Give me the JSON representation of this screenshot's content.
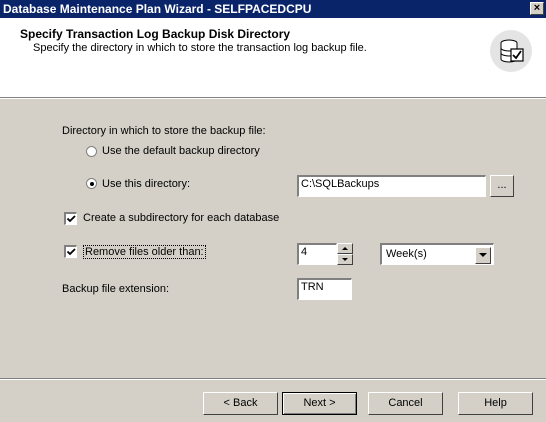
{
  "window": {
    "title": "Database Maintenance Plan Wizard - SELFPACEDCPU",
    "close_glyph": "×"
  },
  "header": {
    "title": "Specify Transaction Log Backup Disk Directory",
    "subtitle": "Specify the directory in which to store the transaction log backup file.",
    "icon": "database-check-icon"
  },
  "form": {
    "directory_label": "Directory in which to store the backup file:",
    "default_dir_option": {
      "label": "Use the default backup directory",
      "selected": false
    },
    "this_dir_option": {
      "label": "Use this directory:",
      "selected": true,
      "value": "C:\\SQLBackups"
    },
    "browse_label": "...",
    "subdirectory": {
      "label": "Create a subdirectory for each database",
      "checked": true
    },
    "remove_files": {
      "label": "Remove files older than:",
      "checked": true,
      "age_value": "4",
      "unit": "Week(s)"
    },
    "extension_label": "Backup file extension:",
    "extension_value": "TRN"
  },
  "buttons": {
    "back": "< Back",
    "next": "Next >",
    "cancel": "Cancel",
    "help": "Help"
  }
}
